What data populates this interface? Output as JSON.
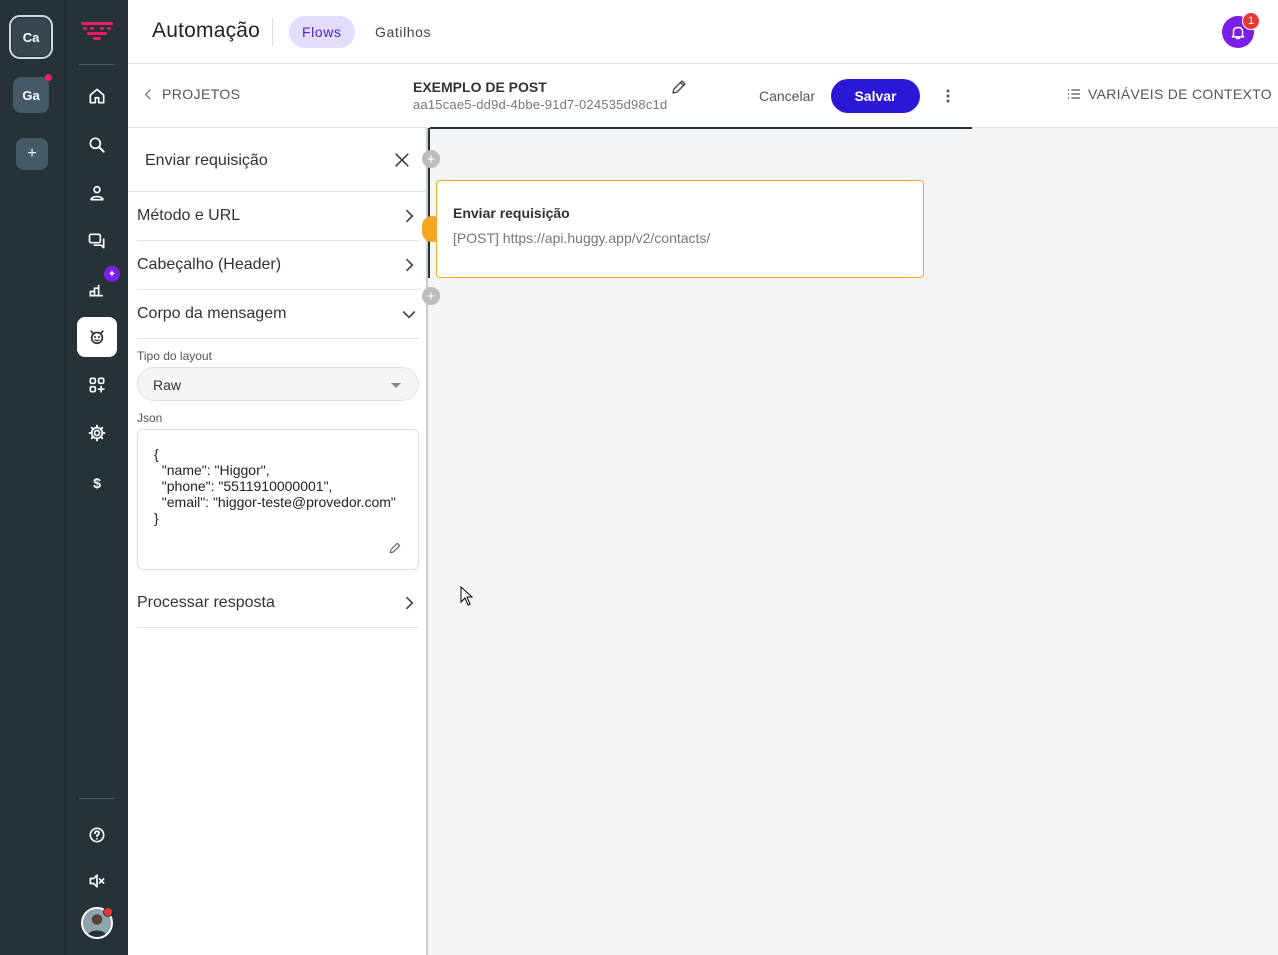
{
  "workspaces": [
    {
      "label": "Ca",
      "active": true,
      "has_dot": false
    },
    {
      "label": "Ga",
      "active": false,
      "has_dot": true
    }
  ],
  "add_workspace_label": "+",
  "nav": {
    "items": [
      "home-icon",
      "search-icon",
      "contacts-icon",
      "chats-icon",
      "reports-icon",
      "automation-icon",
      "apps-icon",
      "settings-icon",
      "billing-icon"
    ],
    "active": "automation-icon",
    "reports_badge_symbol": "✦",
    "bottom": [
      "help-icon",
      "mute-icon",
      "avatar"
    ]
  },
  "header": {
    "title": "Automação",
    "tabs": [
      {
        "label": "Flows",
        "active": true
      },
      {
        "label": "Gatilhos",
        "active": false
      }
    ],
    "notification_count": "1"
  },
  "subbar": {
    "back_label": "PROJETOS",
    "project_name": "EXEMPLO DE POST",
    "project_id": "aa15cae5-dd9d-4bbe-91d7-024535d98c1d",
    "cancel_label": "Cancelar",
    "save_label": "Salvar",
    "context_vars_label": "VARIÁVEIS DE CONTEXTO"
  },
  "panel": {
    "title": "Enviar requisição",
    "sections": [
      {
        "label": "Método e URL",
        "expanded": false
      },
      {
        "label": "Cabeçalho (Header)",
        "expanded": false
      },
      {
        "label": "Corpo da mensagem",
        "expanded": true
      },
      {
        "label": "Processar resposta",
        "expanded": false
      }
    ],
    "layout_type_label": "Tipo do layout",
    "layout_type_value": "Raw",
    "json_label": "Json",
    "json_value": "{\n  \"name\": \"Higgor\",\n  \"phone\": \"5511910000001\",\n  \"email\": \"higgor-teste@provedor.com\"\n}"
  },
  "canvas": {
    "node": {
      "title": "Enviar requisição",
      "subtitle": "[POST] https://api.huggy.app/v2/contacts/"
    },
    "plus_symbol": "+"
  },
  "colors": {
    "rail_bg": "#263238",
    "accent": "#2b17d6",
    "tab_active_bg": "#e4dcfb",
    "node_border": "#f5a623",
    "notification": "#7b1fe6"
  }
}
